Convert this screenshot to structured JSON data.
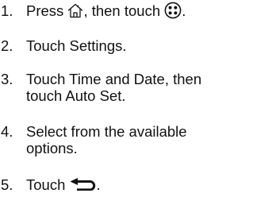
{
  "steps": [
    {
      "number": "1.",
      "segments": [
        "Press",
        ", then touch",
        "."
      ],
      "icons": [
        "home-icon",
        "apps-menu-icon"
      ]
    },
    {
      "number": "2.",
      "text": "Touch Settings."
    },
    {
      "number": "3.",
      "lines": [
        "Touch Time and Date, then",
        "touch Auto Set."
      ]
    },
    {
      "number": "4.",
      "lines": [
        "Select from the available",
        "options."
      ]
    },
    {
      "number": "5.",
      "segments": [
        "Touch",
        "."
      ],
      "icons": [
        "back-arrow-icon"
      ]
    }
  ]
}
